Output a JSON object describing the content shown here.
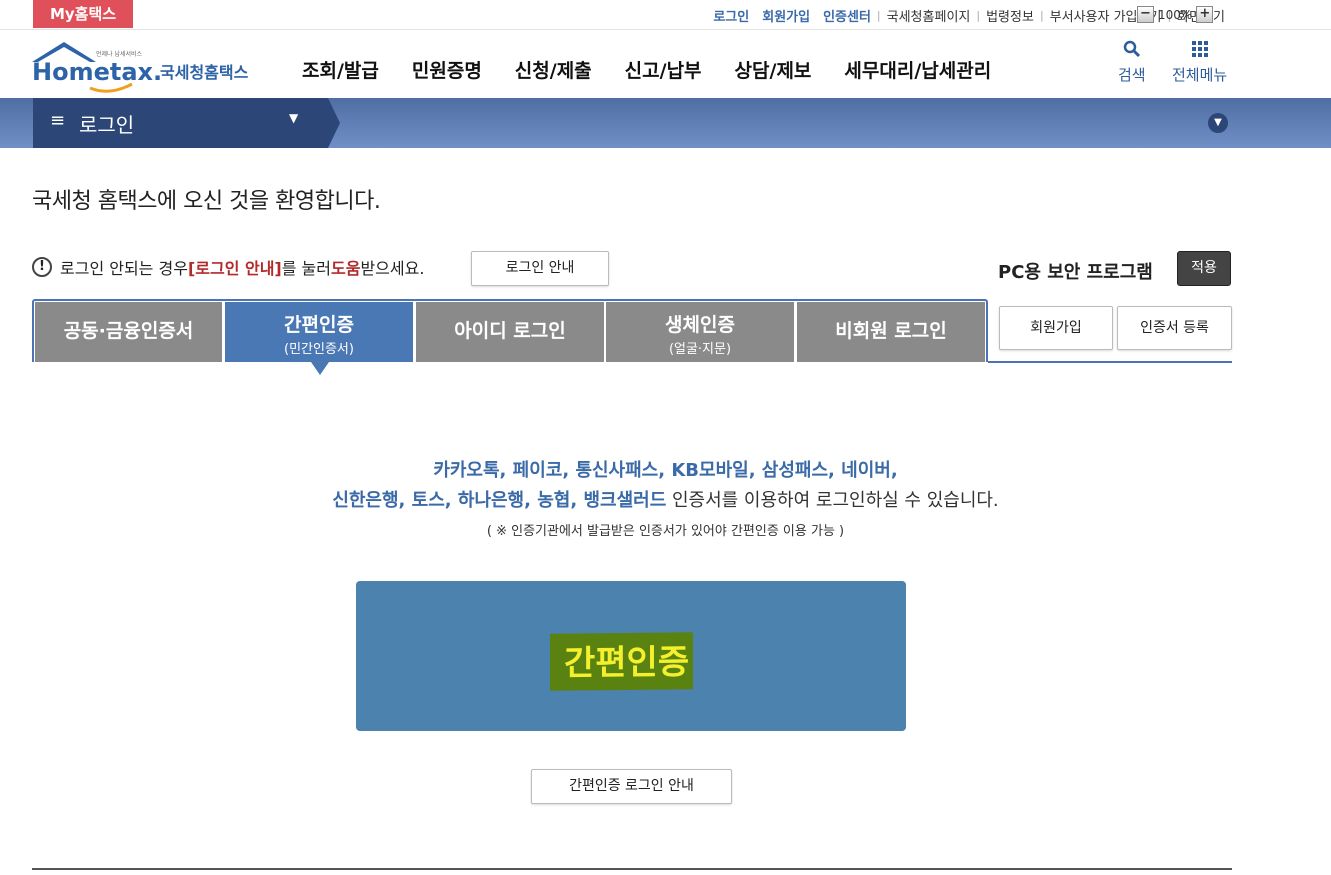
{
  "topbar": {
    "my_hometax": "My홈택스",
    "links": [
      "로그인",
      "회원가입",
      "인증센터"
    ],
    "plain_links": [
      "국세청홈페이지",
      "법령정보",
      "부서사용자 가입하기",
      "화면크기"
    ],
    "zoom_minus": "−",
    "zoom_value": "100%",
    "zoom_plus": "+"
  },
  "header": {
    "logo_small": "언제나 납세서비스",
    "logo_main": "Hometax.",
    "logo_kor": "국세청홈택스",
    "menu": [
      "조회/발급",
      "민원증명",
      "신청/제출",
      "신고/납부",
      "상담/제보",
      "세무대리/납세관리"
    ],
    "search_label": "검색",
    "allmenu_label": "전체메뉴"
  },
  "navbar": {
    "menu_icon": "≡",
    "current": "로그인",
    "caret": "▼",
    "toggle": "▼"
  },
  "welcome": "국세청 홈택스에 오신 것을 환영합니다.",
  "notice": {
    "prefix": "로그인 안되는 경우 ",
    "emph1": "[로그인 안내]",
    "mid": "를 눌러 ",
    "emph2": "도움",
    "suffix": "받으세요.",
    "button": "로그인 안내"
  },
  "pc_security": {
    "label": "PC용 보안 프로그램",
    "apply": "적용"
  },
  "side_buttons": {
    "signup": "회원가입",
    "cert_register": "인증서 등록"
  },
  "tabs": [
    {
      "label": "공동·금융인증서",
      "sub": ""
    },
    {
      "label": "간편인증",
      "sub": "(민간인증서)"
    },
    {
      "label": "아이디 로그인",
      "sub": ""
    },
    {
      "label": "생체인증",
      "sub": "(얼굴·지문)"
    },
    {
      "label": "비회원 로그인",
      "sub": ""
    }
  ],
  "content": {
    "line1": "카카오톡, 페이코, 통신사패스, KB모바일, 삼성패스, 네이버,",
    "line2_blue": "신한은행, 토스, 하나은행, 농협, 뱅크샐러드",
    "line2_rest": " 인증서를 이용하여 로그인하실 수 있습니다.",
    "note": "( ※ 인증기관에서 발급받은 인증서가 있어야 간편인증 이용 가능 )",
    "big_button": "간편인증",
    "guide_button": "간편인증 로그인 안내"
  }
}
